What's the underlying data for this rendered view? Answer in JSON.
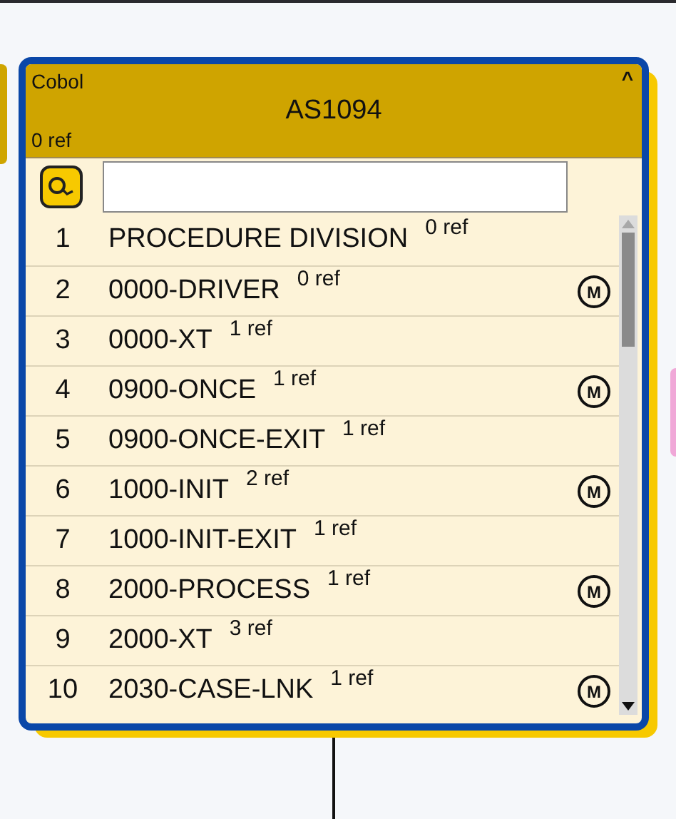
{
  "node": {
    "type_label": "Cobol",
    "title": "AS1094",
    "refs": "0 ref",
    "collapse_glyph": "^",
    "expanded": true
  },
  "rows": [
    {
      "number": "1",
      "name": "PROCEDURE DIVISION",
      "refs": "0 ref"
    },
    {
      "number": "2",
      "name": "0000-DRIVER",
      "refs": "0 ref",
      "badge": "M"
    },
    {
      "number": "3",
      "name": "0000-XT",
      "refs": "1 ref"
    },
    {
      "number": "4",
      "name": "0900-ONCE",
      "refs": "1 ref",
      "badge": "M"
    },
    {
      "number": "5",
      "name": "0900-ONCE-EXIT",
      "refs": "1 ref"
    },
    {
      "number": "6",
      "name": "1000-INIT",
      "refs": "2 ref",
      "badge": "M"
    },
    {
      "number": "7",
      "name": "1000-INIT-EXIT",
      "refs": "1 ref"
    },
    {
      "number": "8",
      "name": "2000-PROCESS",
      "refs": "1 ref",
      "badge": "M"
    },
    {
      "number": "9",
      "name": "2000-XT",
      "refs": "3 ref"
    },
    {
      "number": "10",
      "name": "2030-CASE-LNK",
      "refs": "1 ref",
      "badge": "M"
    }
  ]
}
